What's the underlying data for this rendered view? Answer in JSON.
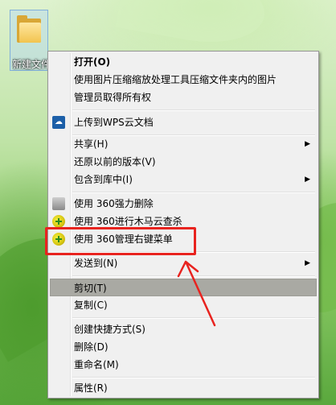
{
  "desktop": {
    "folder_label": "新建文件夹"
  },
  "menu": {
    "items": [
      {
        "label": "打开(O)",
        "bold": true
      },
      {
        "label": "使用图片压缩缩放处理工具压缩文件夹内的图片"
      },
      {
        "label": "管理员取得所有权"
      },
      {
        "label": "上传到WPS云文档",
        "icon": "wps-cloud-icon"
      },
      {
        "label": "共享(H)",
        "submenu": true
      },
      {
        "label": "还原以前的版本(V)"
      },
      {
        "label": "包含到库中(I)",
        "submenu": true
      },
      {
        "label": "使用 360强力删除",
        "icon": "shredder-icon"
      },
      {
        "label": "使用 360进行木马云查杀",
        "icon": "360-icon"
      },
      {
        "label": "使用 360管理右键菜单",
        "icon": "360-icon"
      },
      {
        "label": "发送到(N)",
        "submenu": true
      },
      {
        "label": "剪切(T)",
        "highlighted": true
      },
      {
        "label": "复制(C)"
      },
      {
        "label": "创建快捷方式(S)"
      },
      {
        "label": "删除(D)"
      },
      {
        "label": "重命名(M)"
      },
      {
        "label": "属性(R)"
      }
    ],
    "submenu_arrow": "▶"
  },
  "colors": {
    "menu_bg": "#f0f0f0",
    "highlight": "#a9a9a3",
    "annotation": "#e8231f"
  }
}
